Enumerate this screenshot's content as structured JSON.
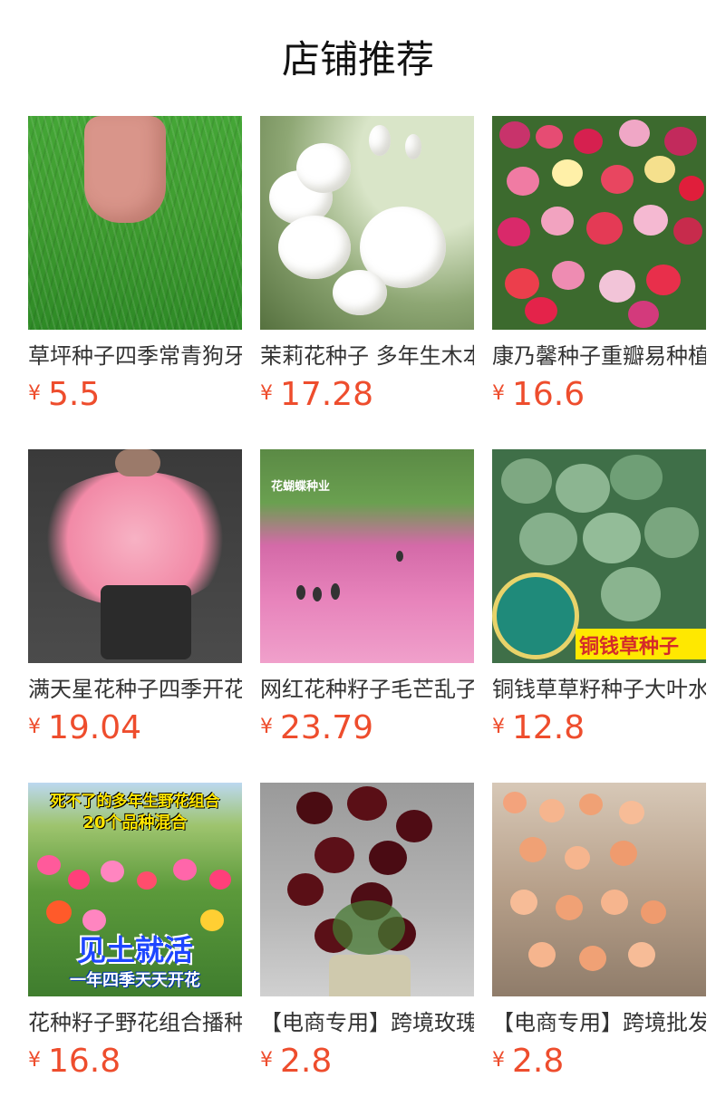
{
  "section_title": "店铺推荐",
  "currency_symbol": "¥",
  "products": [
    {
      "name": "草坪种子四季常青狗牙根",
      "price": "5.5",
      "image": "lawn-grass-photo"
    },
    {
      "name": "茉莉花种子 多年生木本",
      "price": "17.28",
      "image": "jasmine-flower-photo"
    },
    {
      "name": "康乃馨种子重瓣易种植",
      "price": "16.6",
      "image": "carnation-flower-photo"
    },
    {
      "name": "满天星花种子四季开花",
      "price": "19.04",
      "image": "babys-breath-bouquet-photo"
    },
    {
      "name": "网红花种籽子毛芒乱子草",
      "price": "23.79",
      "image": "pink-muhly-field-photo",
      "overlay": {
        "brand": "花蝴蝶种业"
      }
    },
    {
      "name": "铜钱草草籽种子大叶水培",
      "price": "12.8",
      "image": "pennywort-photo",
      "overlay": {
        "label": "铜钱草种子"
      }
    },
    {
      "name": "花种籽子野花组合播种",
      "price": "16.8",
      "image": "wildflower-mix-photo",
      "overlay": {
        "line1": "死不了的多年生野花组合",
        "line2": "20个品种混合",
        "line3": "见土就活",
        "line4": "一年四季天天开花"
      }
    },
    {
      "name": "【电商专用】跨境玫瑰种子",
      "price": "2.8",
      "image": "dark-red-rose-photo"
    },
    {
      "name": "【电商专用】跨境批发种子",
      "price": "2.8",
      "image": "climbing-rose-photo"
    }
  ]
}
